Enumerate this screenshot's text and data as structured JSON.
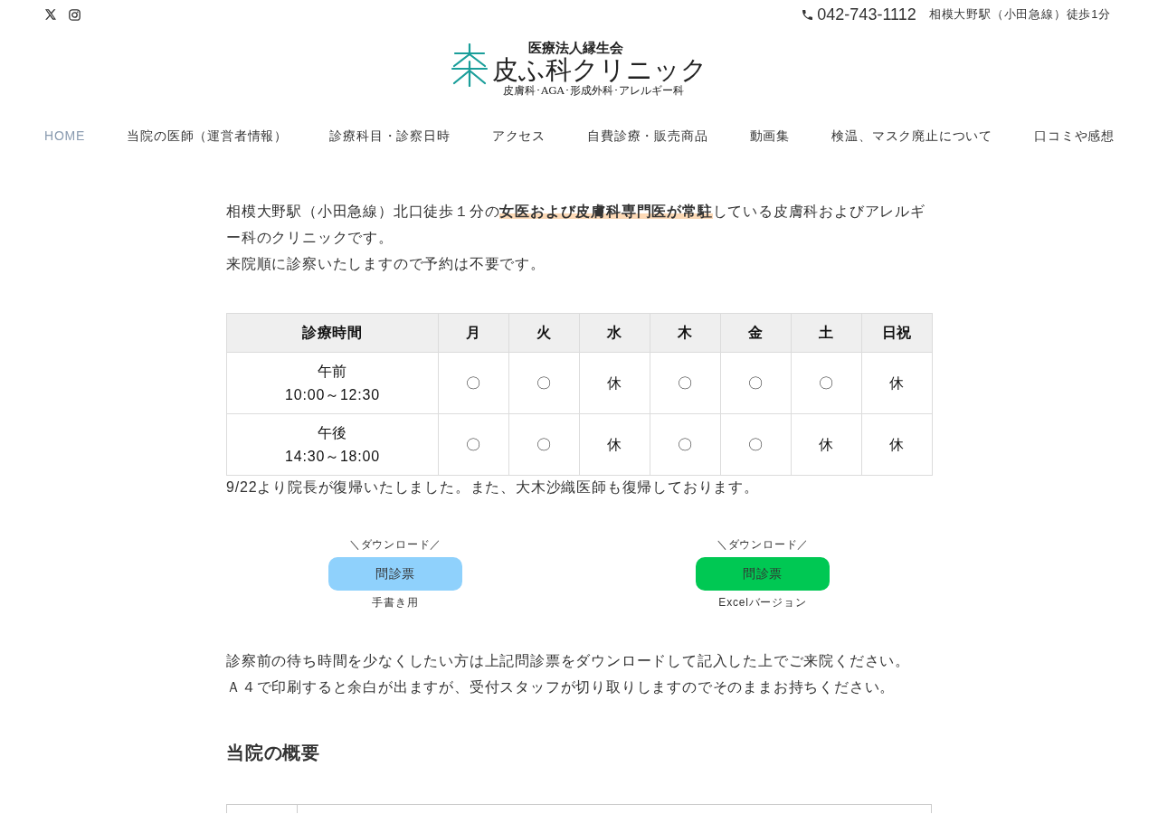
{
  "top_bar": {
    "phone": "042-743-1112",
    "access": "相模大野駅（小田急線）徒歩1分"
  },
  "logo": {
    "org": "医療法人縁生会",
    "name": "皮ふ科クリニック",
    "specialties": "皮膚科･AGA･形成外科･アレルギー科"
  },
  "nav": {
    "items": [
      {
        "label": "HOME",
        "selected": true
      },
      {
        "label": "当院の医師（運営者情報）",
        "selected": false
      },
      {
        "label": "診療科目・診察日時",
        "selected": false
      },
      {
        "label": "アクセス",
        "selected": false
      },
      {
        "label": "自費診療・販売商品",
        "selected": false
      },
      {
        "label": "動画集",
        "selected": false
      },
      {
        "label": "検温、マスク廃止について",
        "selected": false
      },
      {
        "label": "口コミや感想",
        "selected": false
      }
    ]
  },
  "intro": [
    "相模大野駅（小田急線）北口徒歩１分の**女医および皮膚科専門医が常駐**している皮膚科およびアレルギー科のクリニックです。",
    "来院順に診察いたしますので予約は不要です。"
  ],
  "schedule": {
    "columns": [
      "診療時間",
      "月",
      "火",
      "水",
      "木",
      "金",
      "土",
      "日祝"
    ],
    "rows": [
      {
        "period": "午前",
        "time": "10:00～12:30",
        "days": [
          "〇",
          "〇",
          "休",
          "〇",
          "〇",
          "〇",
          "休"
        ]
      },
      {
        "period": "午後",
        "time": "14:30～18:00",
        "days": [
          "〇",
          "〇",
          "休",
          "〇",
          "〇",
          "休",
          "休"
        ]
      }
    ]
  },
  "notice": "9/22より院長が復帰いたしました。また、大木沙織医師も復帰しております。",
  "downloads": [
    {
      "caption": "＼ダウンロード／",
      "label": "問診票",
      "note": "手書き用",
      "color": "#8fd1fc"
    },
    {
      "caption": "＼ダウンロード／",
      "label": "問診票",
      "note": "Excelバージョン",
      "color": "#00c853"
    }
  ],
  "instructions": [
    "診察前の待ち時間を少なくしたい方は上記問診票をダウンロードして記入した上でご来院ください。",
    "Ａ４で印刷すると余白が出ますが、受付スタッフが切り取りしますのでそのままお持ちください。"
  ],
  "overview": {
    "title": "当院の概要"
  }
}
